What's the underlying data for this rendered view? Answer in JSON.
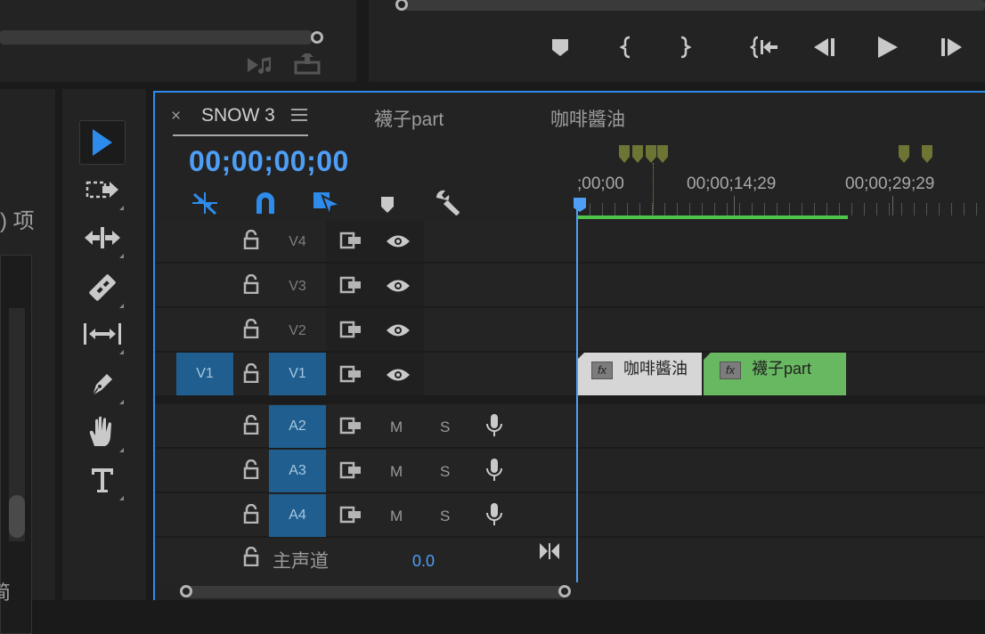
{
  "source_panel": {
    "truncated_label": ") 项",
    "bottom_fragment": "简"
  },
  "program_monitor": {
    "controls": [
      "mark-in-icon",
      "mark-in-bracket-icon",
      "mark-out-bracket-icon",
      "go-to-in-icon",
      "step-back-icon",
      "play-icon",
      "step-forward-icon"
    ]
  },
  "tools": [
    "selection-icon",
    "track-select-icon",
    "ripple-edit-icon",
    "razor-icon",
    "slip-icon",
    "pen-icon",
    "hand-icon",
    "type-icon"
  ],
  "timeline": {
    "tabs": [
      {
        "label": "SNOW 3",
        "active": true
      },
      {
        "label": "襪子part",
        "active": false
      },
      {
        "label": "咖啡醬油",
        "active": false
      }
    ],
    "close_glyph": "×",
    "menu_glyph": "☰",
    "timecode": "00;00;00;00",
    "ruler": {
      "labels": [
        ";00;00",
        "00;00;14;29",
        "00;00;29;29"
      ]
    },
    "video_tracks": [
      {
        "name": "V4",
        "source": "",
        "on": false
      },
      {
        "name": "V3",
        "source": "",
        "on": false
      },
      {
        "name": "V2",
        "source": "",
        "on": false
      },
      {
        "name": "V1",
        "source": "V1",
        "on": true
      }
    ],
    "audio_tracks": [
      {
        "name": "A2",
        "m": "M",
        "s": "S"
      },
      {
        "name": "A3",
        "m": "M",
        "s": "S"
      },
      {
        "name": "A4",
        "m": "M",
        "s": "S"
      }
    ],
    "master": {
      "label": "主声道",
      "value": "0.0"
    },
    "clips": [
      {
        "fx": "fx",
        "label": "咖啡醬油",
        "color": "#d6d6d6"
      },
      {
        "fx": "fx",
        "label": "襪子part",
        "color": "#67b860"
      }
    ]
  }
}
